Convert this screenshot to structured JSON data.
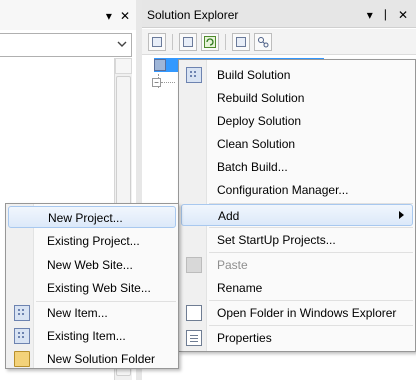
{
  "left_panel": {
    "pin_glyph": "▾",
    "close_glyph": "✕"
  },
  "solution_explorer": {
    "title": "Solution Explorer",
    "dropdown_glyph": "▾",
    "pin_glyph": "ᛁ",
    "close_glyph": "✕",
    "toolbar_icons": [
      "properties-icon",
      "show-all-files-icon",
      "refresh-icon",
      "view-code-icon",
      "class-view-icon"
    ]
  },
  "context_menu": {
    "items": [
      {
        "label": "Build Solution",
        "icon": "build-icon"
      },
      {
        "label": "Rebuild Solution"
      },
      {
        "label": "Deploy Solution"
      },
      {
        "label": "Clean Solution"
      },
      {
        "label": "Batch Build..."
      },
      {
        "label": "Configuration Manager..."
      },
      {
        "label": "Add",
        "has_submenu": true
      },
      {
        "label": "Set StartUp Projects..."
      },
      {
        "label": "Paste",
        "disabled": true,
        "icon": "paste-icon"
      },
      {
        "label": "Rename"
      },
      {
        "label": "Open Folder in Windows Explorer",
        "icon": "folder-icon"
      },
      {
        "label": "Properties",
        "icon": "properties-icon"
      }
    ]
  },
  "add_submenu": {
    "items": [
      {
        "label": "New Project..."
      },
      {
        "label": "Existing Project..."
      },
      {
        "label": "New Web Site..."
      },
      {
        "label": "Existing Web Site..."
      },
      {
        "label": "New Item...",
        "icon": "new-item-icon"
      },
      {
        "label": "Existing Item...",
        "icon": "existing-item-icon"
      },
      {
        "label": "New Solution Folder",
        "icon": "new-folder-icon"
      }
    ]
  }
}
